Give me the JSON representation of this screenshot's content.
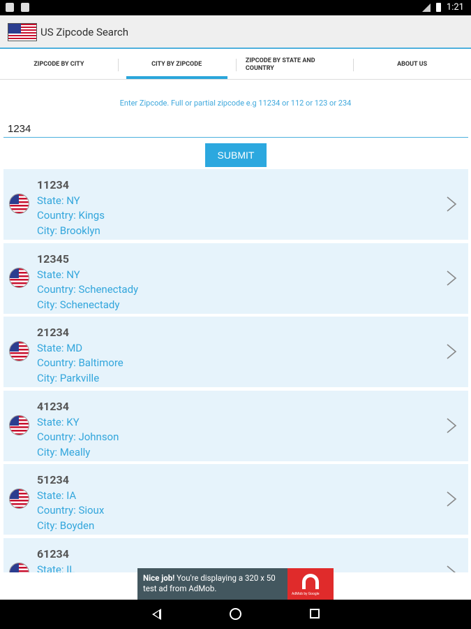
{
  "status_bar": {
    "time": "1:21"
  },
  "app": {
    "title": "US Zipcode Search"
  },
  "tabs": [
    {
      "label": "ZIPCODE BY CITY",
      "active": false
    },
    {
      "label": "CITY BY ZIPCODE",
      "active": true
    },
    {
      "label": "ZIPCODE BY STATE AND COUNTRY",
      "active": false
    },
    {
      "label": "ABOUT US",
      "active": false
    }
  ],
  "search": {
    "hint": "Enter Zipcode. Full or partial zipcode e.g 11234 or 112 or 123 or 234",
    "value": "1234",
    "submit_label": "SUBMIT"
  },
  "results": [
    {
      "zip": "11234",
      "state": "State: NY",
      "country": "Country: Kings",
      "city": "City: Brooklyn"
    },
    {
      "zip": "12345",
      "state": "State: NY",
      "country": "Country: Schenectady",
      "city": "City: Schenectady"
    },
    {
      "zip": "21234",
      "state": "State: MD",
      "country": "Country: Baltimore",
      "city": "City: Parkville"
    },
    {
      "zip": "41234",
      "state": "State: KY",
      "country": "Country: Johnson",
      "city": "City: Meally"
    },
    {
      "zip": "51234",
      "state": "State: IA",
      "country": "Country: Sioux",
      "city": "City: Boyden"
    },
    {
      "zip": "61234",
      "state": "State: IL",
      "country": "",
      "city": ""
    }
  ],
  "ad": {
    "bold": "Nice job!",
    "text": " You're displaying a 320 x 50 test ad from AdMob.",
    "logo_caption": "AdMob by Google"
  },
  "colors": {
    "accent": "#2ca8df",
    "card_bg": "#e6f3fb",
    "text_blue": "#33a6dc"
  }
}
